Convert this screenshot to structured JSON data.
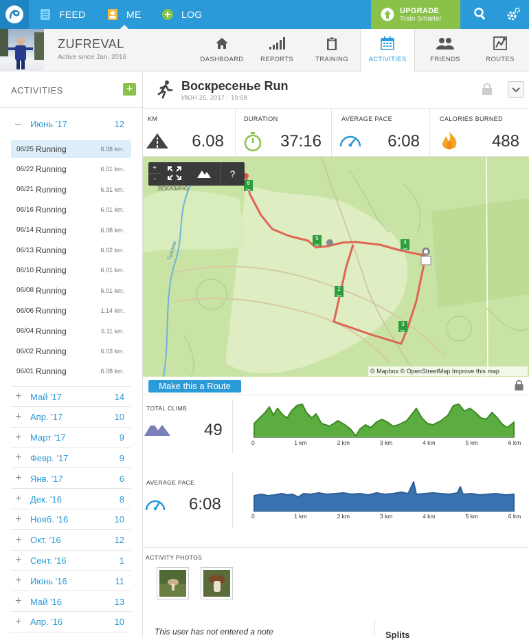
{
  "topbar": {
    "feed": "FEED",
    "me": "ME",
    "log": "LOG",
    "upgrade_title": "UPGRADE",
    "upgrade_sub": "Train Smarter"
  },
  "profile": {
    "name": "ZUFREVAL",
    "since": "Active since Jan, 2016"
  },
  "tabs": [
    "DASHBOARD",
    "REPORTS",
    "TRAINING",
    "ACTIVITIES",
    "FRIENDS",
    "ROUTES"
  ],
  "sidebar": {
    "title": "ACTIVITIES",
    "add": "+",
    "open_month": {
      "label": "Июнь '17",
      "count": "12",
      "toggle": "–"
    },
    "runs": [
      {
        "date": "06/25",
        "type": "Running",
        "km": "6.08 km."
      },
      {
        "date": "06/22",
        "type": "Running",
        "km": "6.01 km."
      },
      {
        "date": "06/21",
        "type": "Running",
        "km": "6.31 km."
      },
      {
        "date": "06/16",
        "type": "Running",
        "km": "6.01 km."
      },
      {
        "date": "06/14",
        "type": "Running",
        "km": "6.08 km."
      },
      {
        "date": "06/13",
        "type": "Running",
        "km": "6.02 km."
      },
      {
        "date": "06/10",
        "type": "Running",
        "km": "6.01 km."
      },
      {
        "date": "06/08",
        "type": "Running",
        "km": "6.01 km."
      },
      {
        "date": "06/06",
        "type": "Running",
        "km": "1.14 km."
      },
      {
        "date": "06/04",
        "type": "Running",
        "km": "6.11 km."
      },
      {
        "date": "06/02",
        "type": "Running",
        "km": "6.03 km."
      },
      {
        "date": "06/01",
        "type": "Running",
        "km": "6.08 km."
      }
    ],
    "months": [
      {
        "label": "Май '17",
        "count": "14"
      },
      {
        "label": "Апр. '17",
        "count": "10"
      },
      {
        "label": "Март '17",
        "count": "9"
      },
      {
        "label": "Февр. '17",
        "count": "9"
      },
      {
        "label": "Янв. '17",
        "count": "6"
      },
      {
        "label": "Дек. '16",
        "count": "8"
      },
      {
        "label": "Нояб. '16",
        "count": "10"
      },
      {
        "label": "Окт. '16",
        "count": "12"
      },
      {
        "label": "Сент. '16",
        "count": "1"
      },
      {
        "label": "Июнь '16",
        "count": "11"
      },
      {
        "label": "Май '16",
        "count": "13"
      },
      {
        "label": "Апр. '16",
        "count": "10"
      }
    ]
  },
  "activity": {
    "title": "Воскресенье Run",
    "date": "ИЮН 25, 2017  ·  19:58",
    "stats": [
      {
        "label": "KM",
        "value": "6.08"
      },
      {
        "label": "DURATION",
        "value": "37:16"
      },
      {
        "label": "AVERAGE PACE",
        "value": "6:08"
      },
      {
        "label": "CALORIES BURNED",
        "value": "488"
      }
    ]
  },
  "map": {
    "zoom_in": "+",
    "zoom_out": "-",
    "help": "?",
    "village": "ВОХАЗИНО",
    "river": "Тыклем",
    "markers": [
      "5",
      "4",
      "2",
      "3"
    ],
    "km_tag": "km",
    "attribution_mapbox": "© Mapbox",
    "attribution_osm": "© OpenStreetMap",
    "improve": "Improve this map",
    "route_button": "Make this a Route"
  },
  "charts": {
    "climb": {
      "label": "TOTAL CLIMB",
      "value": "49"
    },
    "pace": {
      "label": "AVERAGE PACE",
      "value": "6:08"
    },
    "x_ticks": [
      "0",
      "1 km",
      "2 km",
      "3 km",
      "4 km",
      "5 km",
      "6 km"
    ]
  },
  "photos": {
    "title": "ACTIVITY PHOTOS"
  },
  "note": "This user has not entered a note",
  "splits": "Splits",
  "colors": {
    "primary": "#2b9ad8",
    "green": "#8ac249",
    "route": "#e0554a",
    "climb": "#5aad3e",
    "pace": "#3a72b0"
  }
}
